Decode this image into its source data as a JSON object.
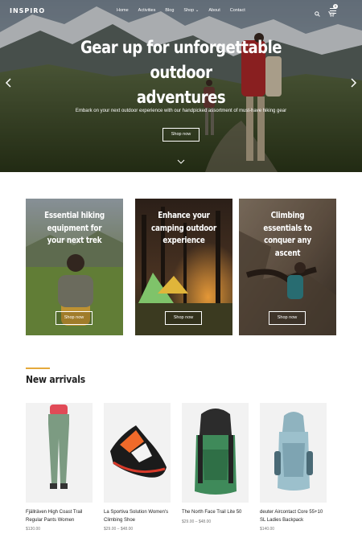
{
  "nav": {
    "logo": "INSPIRO",
    "menu": [
      "Home",
      "Activities",
      "Blog",
      "Shop",
      "About",
      "Contact"
    ],
    "cart_count": "0"
  },
  "hero": {
    "title_line1": "Gear up for unforgettable outdoor",
    "title_line2": "adventures",
    "subtitle": "Embark on your next outdoor experience with our handpicked assortment of must-have hiking gear",
    "button": "Shop now"
  },
  "promos": [
    {
      "title": "Essential hiking equipment for your next trek",
      "button": "Shop now"
    },
    {
      "title": "Enhance your camping outdoor experience",
      "button": "Shop now"
    },
    {
      "title": "Climbing essentials to conquer any ascent",
      "button": "Shop now"
    }
  ],
  "new_arrivals": {
    "heading": "New arrivals",
    "products": [
      {
        "name": "Fjällräven High Coast Trail Regular Pants Women",
        "price": "$130.00"
      },
      {
        "name": "La Sportiva Solution Women's Climbing Shoe",
        "price": "$29.00 – $48.00"
      },
      {
        "name": "The North Face Trail Lite 50",
        "price": "$29.00 – $48.00"
      },
      {
        "name": "deuter Aircontact Core 55+10 SL Ladies Backpack",
        "price": "$140.00"
      }
    ]
  },
  "colors": {
    "accent": "#e5a93b",
    "text": "#222222",
    "muted": "#777777"
  }
}
